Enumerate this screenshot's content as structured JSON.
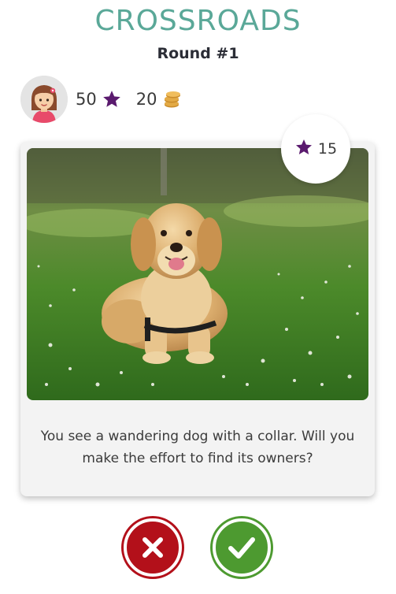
{
  "header": {
    "title": "CROSSROADS",
    "round": "Round #1"
  },
  "player": {
    "avatar_icon": "girl-avatar-icon",
    "stars": "50",
    "star_icon": "star-icon",
    "coins": "20",
    "coin_icon": "coin-stack-icon"
  },
  "card": {
    "reward_stars": "15",
    "image_subject": "golden-retriever-dog-on-grass",
    "question": "You see a wandering dog with a collar. Will you make the effort to find its owners?"
  },
  "actions": {
    "reject_icon": "x-icon",
    "accept_icon": "check-icon"
  },
  "colors": {
    "title": "#5aa898",
    "star": "#5a1a6e",
    "coin": "#d9a23a",
    "reject": "#b3101a",
    "accept": "#4d9a30"
  }
}
